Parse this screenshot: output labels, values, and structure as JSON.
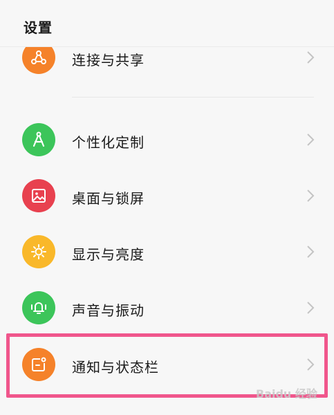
{
  "header": {
    "title": "设置"
  },
  "items": [
    {
      "label": "连接与共享",
      "icon": "share-link-icon",
      "color": "#f5822a"
    },
    {
      "label": "个性化定制",
      "icon": "compass-icon",
      "color": "#3cc55a"
    },
    {
      "label": "桌面与锁屏",
      "icon": "image-icon",
      "color": "#e8414f"
    },
    {
      "label": "显示与亮度",
      "icon": "sun-icon",
      "color": "#f9b82a"
    },
    {
      "label": "声音与振动",
      "icon": "bell-vibrate-icon",
      "color": "#3cc55a"
    },
    {
      "label": "通知与状态栏",
      "icon": "notification-icon",
      "color": "#f5822a"
    }
  ],
  "highlight_color": "#f0568c",
  "watermark": "Baidu 经验"
}
